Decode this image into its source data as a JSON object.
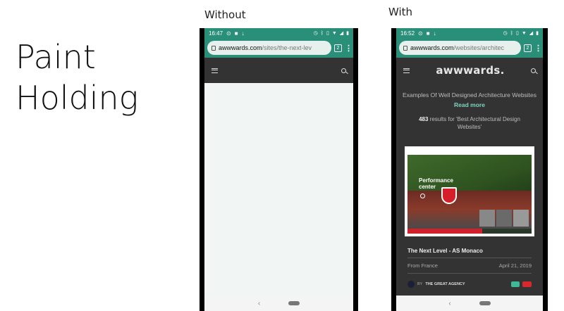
{
  "slide": {
    "title_line1": "Paint",
    "title_line2": "Holding",
    "label_without": "Without",
    "label_with": "With"
  },
  "without": {
    "status": {
      "time": "16:47"
    },
    "url": {
      "host": "awwwards.com",
      "path": "/sites/the-next-lev",
      "tab_count": "2"
    },
    "icons": [
      "menu-icon",
      "search-icon",
      "back-icon",
      "home-icon"
    ]
  },
  "with": {
    "status": {
      "time": "16:52"
    },
    "url": {
      "host": "awwwards.com",
      "path": "/websites/architec",
      "tab_count": "2"
    },
    "site": {
      "logo": "awwwards.",
      "subtitle": "Examples Of Well Designed Architecture Websites",
      "read_more": "Read more",
      "results_count": "483",
      "results_text": " results for 'Best Architectural Design Websites'"
    },
    "card": {
      "thumb_text_line1": "Performance",
      "thumb_text_line2": "center",
      "title": "The Next Level - AS Monaco",
      "from": "From France",
      "date": "April 21, 2019",
      "agency_prefix": "BY",
      "agency_name": "THE GREAT AGENCY"
    },
    "colors": {
      "browser_green": "#2a8f79",
      "site_dark": "#333333",
      "read_more": "#7fd4c0",
      "monaco_red": "#d51f2a"
    }
  }
}
